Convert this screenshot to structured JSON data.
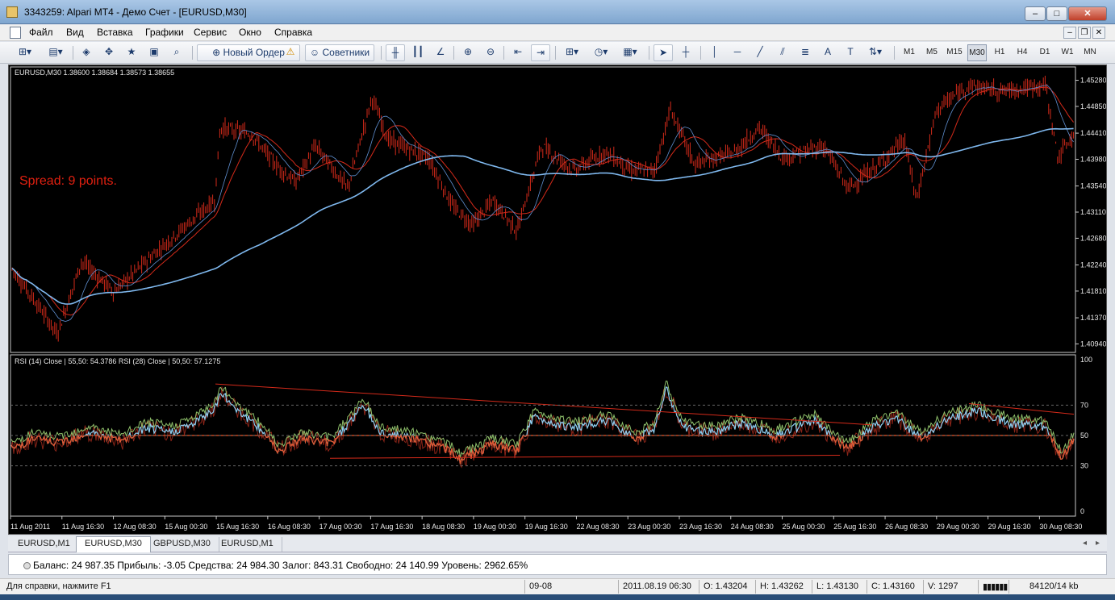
{
  "window": {
    "title": "3343259: Alpari MT4 - Демо Счет - [EURUSD,M30]"
  },
  "menu": [
    "Файл",
    "Вид",
    "Вставка",
    "Графики",
    "Сервис",
    "Окно",
    "Справка"
  ],
  "toolbar": {
    "new_order": "Новый Ордер",
    "experts": "Советники",
    "timeframes": [
      "M1",
      "M5",
      "M15",
      "M30",
      "H1",
      "H4",
      "D1",
      "W1",
      "MN"
    ],
    "active_timeframe": "M30"
  },
  "chart": {
    "header": "EURUSD,M30  1.38600 1.38684 1.38573 1.38655",
    "spread_text": "Spread: 9 points.",
    "price_ticks": [
      "1.45280",
      "1.44850",
      "1.44410",
      "1.43980",
      "1.43540",
      "1.43110",
      "1.42680",
      "1.42240",
      "1.41810",
      "1.41370",
      "1.40940"
    ],
    "indicator_header": "RSI (14) Close | 55,50: 54.3786  RSI (28) Close | 50,50: 57.1275",
    "rsi_ticks": [
      "100",
      "70",
      "50",
      "30",
      "0"
    ],
    "time_labels": [
      "11 Aug 2011",
      "11 Aug 16:30",
      "12 Aug 08:30",
      "15 Aug 00:30",
      "15 Aug 16:30",
      "16 Aug 08:30",
      "17 Aug 00:30",
      "17 Aug 16:30",
      "18 Aug 08:30",
      "19 Aug 00:30",
      "19 Aug 16:30",
      "22 Aug 08:30",
      "23 Aug 00:30",
      "23 Aug 16:30",
      "24 Aug 08:30",
      "25 Aug 00:30",
      "25 Aug 16:30",
      "26 Aug 08:30",
      "29 Aug 00:30",
      "29 Aug 16:30",
      "30 Aug 08:30"
    ],
    "colors": {
      "candles": "#d42a1a",
      "ma_fast": "#d42a1a",
      "ma_slow": "#7fb8ee",
      "rsi14": "#8fd0f2",
      "rsi14_low": "#e8552a",
      "rsi28_high": "#8fc16b",
      "trendline": "#d42a1a",
      "spread_text": "#e02010"
    }
  },
  "tabs": [
    "EURUSD,M1",
    "EURUSD,M30",
    "GBPUSD,M30",
    "EURUSD,M1"
  ],
  "active_tab": 1,
  "terminal": {
    "balance": "Баланс: 24 987.35  Прибыль: -3.05  Средства: 24 984.30  Залог: 843.31  Свободно: 24 140.99  Уровень: 2962.65%"
  },
  "status": {
    "help": "Для справки, нажмите F1",
    "profile": "09-08",
    "datetime": "2011.08.19 06:30",
    "open": "O: 1.43204",
    "high": "H: 1.43262",
    "low": "L: 1.43130",
    "close": "C: 1.43160",
    "volume": "V: 1297",
    "traffic": "84120/14 kb"
  }
}
